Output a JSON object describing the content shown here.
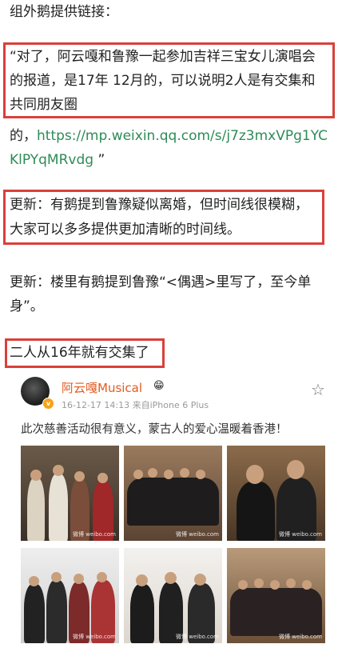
{
  "article": {
    "intro": "组外鹅提供链接：",
    "quote_line1": "“对了，阿云嘎和鲁豫一起参加吉祥三宝女儿演唱会",
    "quote_line2": "的报道，是17年 12月的，可以说明2人是有交集和",
    "quote_line3": "共同朋友圈",
    "link_prefix": "的，",
    "link_part1": "https://mp.weixin.qq.com/s/j7z3mxVPg1YC",
    "link_part2": "KlPYqMRvdg",
    "link_suffix": " ”",
    "update1_line1": "更新：有鹅提到鲁豫疑似离婚，但时间线很模糊，",
    "update1_line2": "大家可以多多提供更加清晰的时间线。",
    "update2_line1": "更新：楼里有鹅提到鲁豫“<偶遇>里写了，至今单",
    "update2_line2": "身”。",
    "heading": "二人从16年就有交集了"
  },
  "weibo": {
    "username": "阿云嘎Musical",
    "emoji": "😁",
    "verified_mark": "v",
    "meta": "16-12-17 14:13  来自iPhone 6 Plus",
    "post_text": "此次慈善活动很有意义，蒙古人的爱心温暖着香港！",
    "watermark": "微博 weibo.com",
    "icons": [
      "avatar",
      "verified-badge",
      "star-icon"
    ]
  },
  "colors": {
    "highlight_border": "#d9403a",
    "link": "#2e8b57",
    "username": "#e25a1f"
  }
}
